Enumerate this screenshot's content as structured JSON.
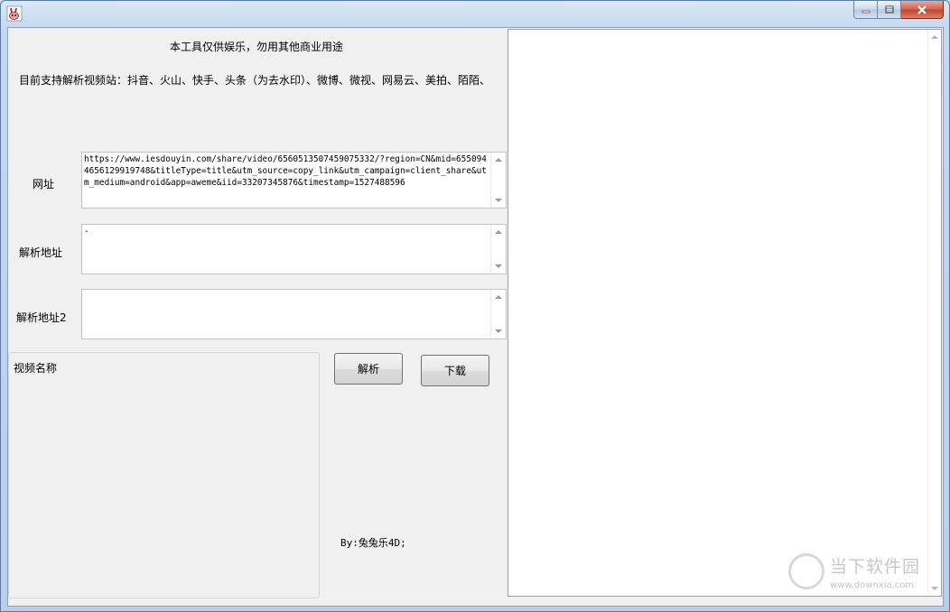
{
  "window": {
    "title": "",
    "controls": {
      "minimize_icon": "minimize-icon",
      "maximize_icon": "maximize-icon",
      "close_icon": "close-icon"
    }
  },
  "header": {
    "notice": "本工具仅供娱乐，勿用其他商业用途",
    "supported_sites": "目前支持解析视频站：抖音、火山、快手、头条（为去水印）、微博、微视、网易云、美拍、陌陌、"
  },
  "form": {
    "url_label": "网址",
    "url_value": "https://www.iesdouyin.com/share/video/6560513507459075332/?region=CN&mid=6550944656129919748&titleType=title&utm_source=copy_link&utm_campaign=client_share&utm_medium=android&app=aweme&iid=33207345876&timestamp=1527488596",
    "parse_label": "解析地址",
    "parse_value": "-",
    "parse2_label": "解析地址2",
    "parse2_value": ""
  },
  "video": {
    "name_label": "视频名称"
  },
  "buttons": {
    "parse": "解析",
    "download": "下载"
  },
  "author": "By:兔兔乐4D;",
  "watermark": {
    "title": "当下软件园",
    "url": "www.downxia.com"
  },
  "colors": {
    "client_bg": "#f0f0f0",
    "titlebar": "#c4d8ef",
    "close": "#c4462e"
  }
}
